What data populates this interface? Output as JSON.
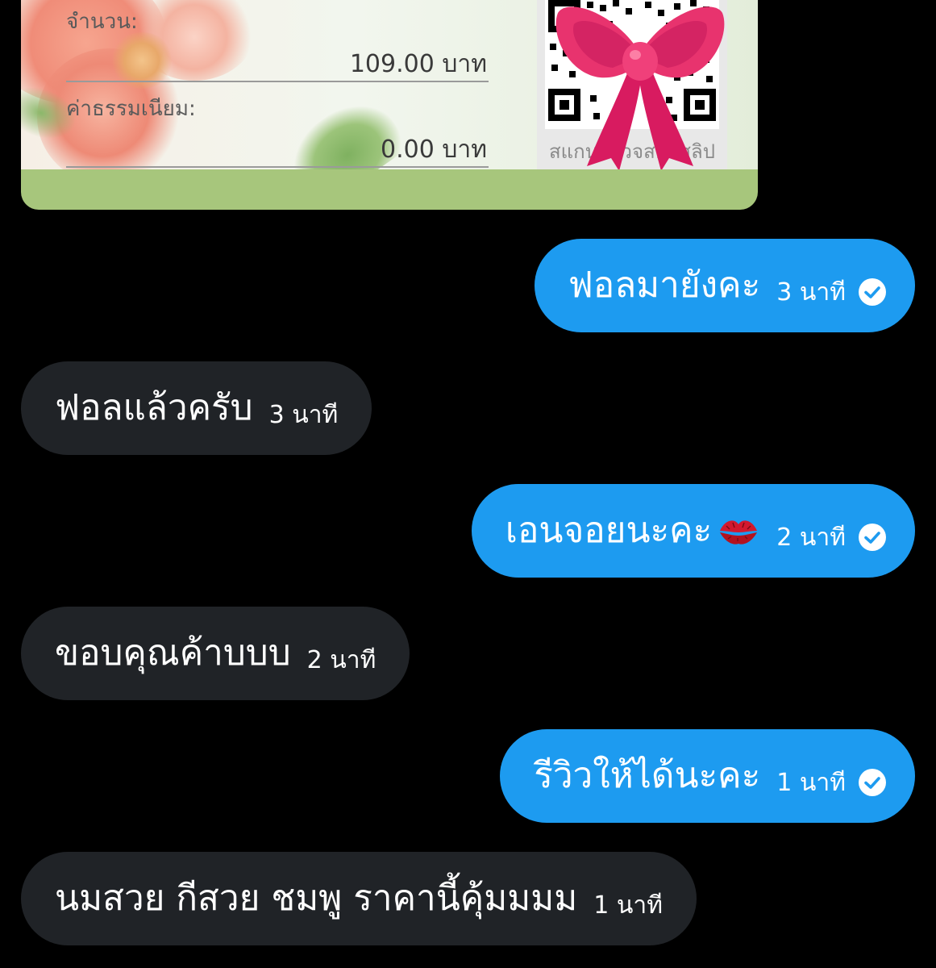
{
  "slip": {
    "amount_label": "จำนวน:",
    "amount_value": "109.00 บาท",
    "fee_label": "ค่าธรรมเนียม:",
    "fee_value": "0.00 บาท",
    "qr_caption": "สแกนตรวจสอบสลิป"
  },
  "messages": [
    {
      "direction": "outgoing",
      "text": "ฟอลมายังคะ",
      "time": "3 นาที",
      "read": true
    },
    {
      "direction": "incoming",
      "text": "ฟอลแล้วครับ",
      "time": "3 นาที"
    },
    {
      "direction": "outgoing",
      "text": "เอนจอยนะคะ",
      "emoji": "kiss-mark",
      "time": "2 นาที",
      "read": true
    },
    {
      "direction": "incoming",
      "text": "ขอบคุณค้าบบบ",
      "time": "2 นาที"
    },
    {
      "direction": "outgoing",
      "text": "รีวิวให้ได้นะคะ",
      "time": "1 นาที",
      "read": true
    },
    {
      "direction": "incoming",
      "text": "นมสวย กีสวย ชมพู ราคานี้คุ้มมมม",
      "time": "1 นาที"
    }
  ],
  "colors": {
    "outgoing_bubble": "#1d9bf0",
    "incoming_bubble": "#202327",
    "background": "#000000",
    "slip_footer": "#a7c67c"
  }
}
